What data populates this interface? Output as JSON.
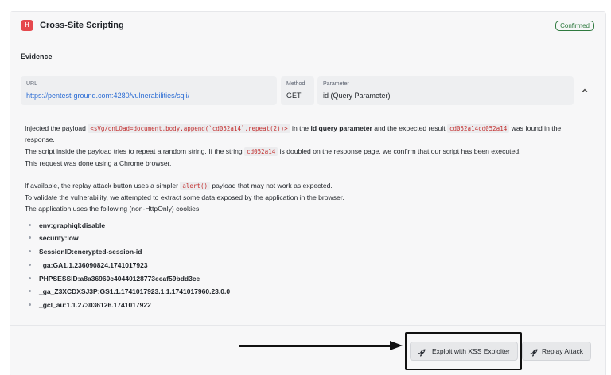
{
  "vulnerability": {
    "severity_letter": "H",
    "title": "Cross-Site Scripting",
    "status": "Confirmed"
  },
  "evidence": {
    "title": "Evidence",
    "url_label": "URL",
    "url_value": "https://pentest-ground.com:4280/vulnerabilities/sqli/",
    "method_label": "Method",
    "method_value": "GET",
    "parameter_label": "Parameter",
    "parameter_value": "id (Query Parameter)"
  },
  "description": {
    "line1_prefix": "Injected the payload ",
    "line1_payload": "<sVg/onLOad=document.body.append(`cd052a14`.repeat(2))>",
    "line1_mid1": " in the ",
    "line1_bold": "id query parameter",
    "line1_mid2": " and the expected result ",
    "line1_result": "cd052a14cd052a14",
    "line1_suffix": " was found in the",
    "line2": "response.",
    "line3_prefix": "The script inside the payload tries to repeat a random string. If the string ",
    "line3_code": "cd052a14",
    "line3_suffix": " is doubled on the response page, we confirm that our script has been executed.",
    "line4": "This request was done using a Chrome browser.",
    "line5_prefix": "If available, the replay attack button uses a simpler ",
    "line5_code": "alert()",
    "line5_suffix": " payload that may not work as expected.",
    "line6": "To validate the vulnerability, we attempted to extract some data exposed by the application in the browser.",
    "line7": "The application uses the following (non-HttpOnly) cookies:"
  },
  "cookies": [
    "env:graphiql:disable",
    "security:low",
    "SessionID:encrypted-session-id",
    "_ga:GA1.1.236090824.1741017923",
    "PHPSESSID:a8a36960c40440128773eeaf59bdd3ce",
    "_ga_Z3XCDXSJ3P:GS1.1.1741017923.1.1.1741017960.23.0.0",
    "_gcl_au:1.1.273036126.1741017922"
  ],
  "actions": {
    "exploit_label": "Exploit with XSS Exploiter",
    "replay_label": "Replay Attack"
  },
  "icons": {
    "chevron": "chevron-up-icon",
    "rocket": "rocket-icon"
  },
  "colors": {
    "severity_high": "#e5484d",
    "confirmed": "#2f7a3f",
    "link": "#2b6cd4",
    "code": "#c22e2e"
  }
}
